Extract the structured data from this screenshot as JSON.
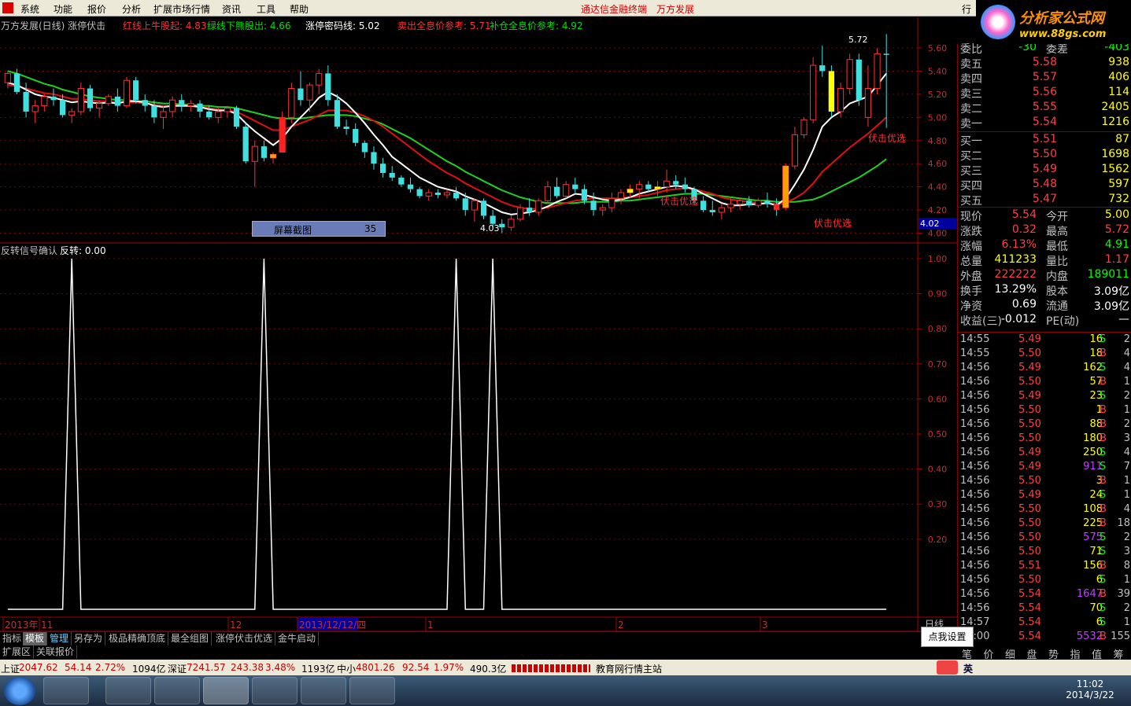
{
  "menu": {
    "items": [
      "系统",
      "功能",
      "报价",
      "分析",
      "扩展市场行情",
      "资讯",
      "工具",
      "帮助"
    ],
    "brand": "通达信金融终端",
    "company": "万方发展",
    "right_label": "行"
  },
  "watermark": {
    "line1": "分析家公式网",
    "line2": "www.88gs.com"
  },
  "header": {
    "title": "万方发展(日线) 涨停伏击",
    "red_up": "红线上牛股起: 4.83",
    "green_down": "绿线下熊股出: 4.66",
    "limit_line": "涨停密码线: 5.02",
    "sell_ref": "卖出全息价参考: 5.71",
    "add_ref": "补仓全息价参考: 4.92"
  },
  "chart_data": {
    "type": "candlestick",
    "x_labels": [
      "2013年",
      "11",
      "12",
      "2013/12/12/四",
      "1",
      "2",
      "3"
    ],
    "y_ticks": [
      "5.60",
      "5.40",
      "5.20",
      "5.00",
      "4.80",
      "4.60",
      "4.40",
      "4.20",
      "4.00"
    ],
    "current_price_marker": "4.02",
    "high_label": "5.72",
    "low_label": "4.03",
    "signal_labels": [
      "伏击优选",
      "伏击优选",
      "伏击优选"
    ],
    "screenshot_box": {
      "label": "屏幕截图",
      "value": "35"
    },
    "ohlc": [
      [
        5.3,
        5.4,
        5.25,
        5.38
      ],
      [
        5.38,
        5.42,
        5.2,
        5.22
      ],
      [
        5.22,
        5.3,
        5.0,
        5.05
      ],
      [
        5.05,
        5.15,
        4.95,
        5.1
      ],
      [
        5.1,
        5.2,
        5.05,
        5.18
      ],
      [
        5.18,
        5.25,
        5.1,
        5.15
      ],
      [
        5.15,
        5.2,
        5.0,
        5.02
      ],
      [
        5.02,
        5.08,
        4.95,
        5.05
      ],
      [
        5.05,
        5.3,
        5.02,
        5.25
      ],
      [
        5.25,
        5.28,
        5.05,
        5.08
      ],
      [
        5.08,
        5.15,
        5.0,
        5.12
      ],
      [
        5.12,
        5.2,
        5.1,
        5.18
      ],
      [
        5.18,
        5.25,
        5.05,
        5.1
      ],
      [
        5.1,
        5.35,
        5.08,
        5.32
      ],
      [
        5.32,
        5.35,
        5.12,
        5.15
      ],
      [
        5.15,
        5.2,
        5.05,
        5.1
      ],
      [
        5.1,
        5.15,
        4.95,
        5.0
      ],
      [
        5.0,
        5.1,
        4.9,
        5.05
      ],
      [
        5.05,
        5.18,
        5.0,
        5.15
      ],
      [
        5.15,
        5.2,
        5.05,
        5.1
      ],
      [
        5.1,
        5.15,
        5.05,
        5.12
      ],
      [
        5.12,
        5.15,
        5.0,
        5.05
      ],
      [
        5.05,
        5.1,
        4.98,
        5.0
      ],
      [
        5.0,
        5.08,
        4.95,
        5.05
      ],
      [
        5.05,
        5.1,
        5.0,
        5.08
      ],
      [
        5.08,
        5.1,
        4.9,
        4.92
      ],
      [
        4.92,
        4.95,
        4.6,
        4.62
      ],
      [
        4.62,
        4.8,
        4.4,
        4.75
      ],
      [
        4.75,
        4.8,
        4.62,
        4.65
      ],
      [
        4.65,
        4.7,
        4.6,
        4.68
      ],
      [
        4.7,
        5.05,
        4.7,
        5.0
      ],
      [
        5.0,
        5.3,
        4.95,
        5.25
      ],
      [
        5.25,
        5.4,
        5.1,
        5.15
      ],
      [
        5.15,
        5.3,
        5.05,
        5.28
      ],
      [
        5.28,
        5.42,
        5.2,
        5.38
      ],
      [
        5.38,
        5.45,
        5.1,
        5.15
      ],
      [
        5.15,
        5.2,
        4.9,
        4.92
      ],
      [
        4.92,
        4.98,
        4.85,
        4.9
      ],
      [
        4.9,
        4.95,
        4.75,
        4.78
      ],
      [
        4.78,
        4.8,
        4.65,
        4.7
      ],
      [
        4.7,
        4.75,
        4.55,
        4.6
      ],
      [
        4.6,
        4.65,
        4.48,
        4.52
      ],
      [
        4.52,
        4.58,
        4.45,
        4.48
      ],
      [
        4.48,
        4.5,
        4.4,
        4.42
      ],
      [
        4.42,
        4.48,
        4.35,
        4.38
      ],
      [
        4.38,
        4.4,
        4.3,
        4.32
      ],
      [
        4.32,
        4.38,
        4.28,
        4.35
      ],
      [
        4.35,
        4.38,
        4.3,
        4.33
      ],
      [
        4.33,
        4.38,
        4.3,
        4.35
      ],
      [
        4.35,
        4.4,
        4.28,
        4.3
      ],
      [
        4.3,
        4.35,
        4.15,
        4.2
      ],
      [
        4.2,
        4.3,
        4.1,
        4.28
      ],
      [
        4.28,
        4.3,
        4.12,
        4.15
      ],
      [
        4.15,
        4.2,
        4.05,
        4.08
      ],
      [
        4.08,
        4.12,
        4.0,
        4.05
      ],
      [
        4.05,
        4.15,
        4.02,
        4.12
      ],
      [
        4.12,
        4.25,
        4.1,
        4.22
      ],
      [
        4.22,
        4.3,
        4.15,
        4.18
      ],
      [
        4.18,
        4.3,
        4.15,
        4.28
      ],
      [
        4.28,
        4.45,
        4.25,
        4.4
      ],
      [
        4.4,
        4.48,
        4.3,
        4.32
      ],
      [
        4.32,
        4.45,
        4.3,
        4.42
      ],
      [
        4.42,
        4.48,
        4.35,
        4.38
      ],
      [
        4.38,
        4.42,
        4.25,
        4.28
      ],
      [
        4.28,
        4.35,
        4.15,
        4.2
      ],
      [
        4.2,
        4.25,
        4.15,
        4.22
      ],
      [
        4.22,
        4.35,
        4.18,
        4.3
      ],
      [
        4.3,
        4.38,
        4.25,
        4.35
      ],
      [
        4.35,
        4.42,
        4.3,
        4.38
      ],
      [
        4.38,
        4.45,
        4.3,
        4.42
      ],
      [
        4.42,
        4.45,
        4.35,
        4.38
      ],
      [
        4.38,
        4.45,
        4.32,
        4.4
      ],
      [
        4.4,
        4.55,
        4.35,
        4.45
      ],
      [
        4.45,
        4.5,
        4.38,
        4.42
      ],
      [
        4.42,
        4.48,
        4.35,
        4.38
      ],
      [
        4.38,
        4.4,
        4.25,
        4.28
      ],
      [
        4.28,
        4.32,
        4.18,
        4.2
      ],
      [
        4.2,
        4.28,
        4.15,
        4.18
      ],
      [
        4.18,
        4.25,
        4.12,
        4.22
      ],
      [
        4.22,
        4.3,
        4.18,
        4.25
      ],
      [
        4.25,
        4.3,
        4.2,
        4.28
      ],
      [
        4.28,
        4.32,
        4.22,
        4.24
      ],
      [
        4.24,
        4.3,
        4.22,
        4.28
      ],
      [
        4.28,
        4.35,
        4.22,
        4.25
      ],
      [
        4.25,
        4.3,
        4.15,
        4.2
      ],
      [
        4.22,
        4.6,
        4.2,
        4.58
      ],
      [
        4.58,
        4.92,
        4.55,
        4.85
      ],
      [
        4.85,
        5.0,
        4.82,
        4.98
      ],
      [
        4.98,
        5.52,
        4.95,
        5.45
      ],
      [
        5.45,
        5.62,
        5.35,
        5.4
      ],
      [
        5.4,
        5.45,
        5.0,
        5.05
      ],
      [
        5.05,
        5.3,
        5.0,
        5.25
      ],
      [
        5.25,
        5.55,
        5.2,
        5.5
      ],
      [
        5.5,
        5.55,
        5.1,
        5.15
      ],
      [
        5.0,
        5.45,
        4.92,
        5.25
      ],
      [
        5.25,
        5.6,
        5.2,
        5.55
      ],
      [
        5.55,
        5.72,
        4.91,
        5.54
      ]
    ],
    "ma_white": [
      5.3,
      5.28,
      5.24,
      5.2,
      5.18,
      5.17,
      5.15,
      5.13,
      5.14,
      5.13,
      5.12,
      5.13,
      5.12,
      5.14,
      5.14,
      5.13,
      5.1,
      5.09,
      5.1,
      5.1,
      5.1,
      5.09,
      5.07,
      5.06,
      5.06,
      5.03,
      4.95,
      4.88,
      4.82,
      4.76,
      4.82,
      4.92,
      5.0,
      5.08,
      5.17,
      5.22,
      5.18,
      5.12,
      5.04,
      4.95,
      4.85,
      4.76,
      4.66,
      4.6,
      4.54,
      4.48,
      4.44,
      4.4,
      4.38,
      4.36,
      4.32,
      4.29,
      4.26,
      4.22,
      4.18,
      4.16,
      4.17,
      4.18,
      4.2,
      4.23,
      4.27,
      4.3,
      4.34,
      4.33,
      4.31,
      4.29,
      4.28,
      4.29,
      4.31,
      4.34,
      4.36,
      4.38,
      4.4,
      4.41,
      4.4,
      4.38,
      4.34,
      4.3,
      4.26,
      4.24,
      4.24,
      4.25,
      4.25,
      4.26,
      4.24,
      4.3,
      4.42,
      4.55,
      4.72,
      4.92,
      5.0,
      5.05,
      5.12,
      5.15,
      5.18,
      5.28,
      5.38
    ],
    "ma_red": [
      5.28,
      5.27,
      5.25,
      5.23,
      5.21,
      5.2,
      5.18,
      5.16,
      5.16,
      5.15,
      5.14,
      5.14,
      5.13,
      5.13,
      5.13,
      5.12,
      5.11,
      5.1,
      5.1,
      5.1,
      5.1,
      5.09,
      5.08,
      5.07,
      5.06,
      5.05,
      5.01,
      4.97,
      4.93,
      4.89,
      4.89,
      4.92,
      4.95,
      4.98,
      5.02,
      5.06,
      5.06,
      5.06,
      5.04,
      5.01,
      4.97,
      4.92,
      4.86,
      4.8,
      4.74,
      4.68,
      4.62,
      4.57,
      4.52,
      4.48,
      4.43,
      4.39,
      4.35,
      4.31,
      4.27,
      4.24,
      4.22,
      4.21,
      4.21,
      4.22,
      4.24,
      4.26,
      4.28,
      4.29,
      4.3,
      4.3,
      4.3,
      4.3,
      4.31,
      4.32,
      4.33,
      4.35,
      4.37,
      4.38,
      4.39,
      4.38,
      4.36,
      4.34,
      4.31,
      4.29,
      4.28,
      4.27,
      4.26,
      4.26,
      4.25,
      4.26,
      4.3,
      4.35,
      4.43,
      4.53,
      4.6,
      4.67,
      4.74,
      4.8,
      4.86,
      4.93,
      5.0
    ],
    "ma_green": [
      5.4,
      5.38,
      5.35,
      5.32,
      5.29,
      5.27,
      5.24,
      5.22,
      5.2,
      5.18,
      5.17,
      5.16,
      5.15,
      5.15,
      5.14,
      5.14,
      5.13,
      5.12,
      5.12,
      5.11,
      5.11,
      5.1,
      5.1,
      5.09,
      5.09,
      5.08,
      5.06,
      5.04,
      5.02,
      5.0,
      4.99,
      4.99,
      4.99,
      5.0,
      5.01,
      5.02,
      5.02,
      5.02,
      5.01,
      4.99,
      4.97,
      4.94,
      4.9,
      4.86,
      4.82,
      4.77,
      4.72,
      4.67,
      4.62,
      4.58,
      4.53,
      4.49,
      4.45,
      4.41,
      4.37,
      4.34,
      4.31,
      4.29,
      4.27,
      4.26,
      4.26,
      4.26,
      4.26,
      4.27,
      4.27,
      4.27,
      4.27,
      4.28,
      4.28,
      4.29,
      4.3,
      4.31,
      4.32,
      4.33,
      4.34,
      4.34,
      4.34,
      4.33,
      4.32,
      4.31,
      4.3,
      4.29,
      4.28,
      4.28,
      4.27,
      4.27,
      4.27,
      4.28,
      4.29,
      4.32,
      4.36,
      4.4,
      4.44,
      4.48,
      4.53,
      4.58,
      4.64
    ],
    "indicator": {
      "title": "反转信号确认",
      "label": "反转: 0.00",
      "y_ticks": [
        "1.00",
        "0.90",
        "0.80",
        "0.70",
        "0.60",
        "0.50",
        "0.40",
        "0.30",
        "0.20"
      ],
      "ylim": [
        0,
        1
      ],
      "spikes_at_bar": [
        7,
        28,
        49,
        53
      ],
      "bars": 97
    }
  },
  "quote": {
    "weibi": {
      "label": "委比",
      "value": "-30",
      "label2": "委差",
      "value2": "-403"
    },
    "asks": [
      {
        "label": "卖五",
        "price": "5.58",
        "vol": "938"
      },
      {
        "label": "卖四",
        "price": "5.57",
        "vol": "406"
      },
      {
        "label": "卖三",
        "price": "5.56",
        "vol": "114"
      },
      {
        "label": "卖二",
        "price": "5.55",
        "vol": "2405"
      },
      {
        "label": "卖一",
        "price": "5.54",
        "vol": "1216"
      }
    ],
    "bids": [
      {
        "label": "买一",
        "price": "5.51",
        "vol": "87"
      },
      {
        "label": "买二",
        "price": "5.50",
        "vol": "1698"
      },
      {
        "label": "买三",
        "price": "5.49",
        "vol": "1562"
      },
      {
        "label": "买四",
        "price": "5.48",
        "vol": "597"
      },
      {
        "label": "买五",
        "price": "5.47",
        "vol": "732"
      }
    ],
    "stats": [
      {
        "l1": "现价",
        "v1": "5.54",
        "c1": "#ff4040",
        "l2": "今开",
        "v2": "5.00",
        "c2": "#ffff00"
      },
      {
        "l1": "涨跌",
        "v1": "0.32",
        "c1": "#ff4040",
        "l2": "最高",
        "v2": "5.72",
        "c2": "#ff4040"
      },
      {
        "l1": "涨幅",
        "v1": "6.13%",
        "c1": "#ff4040",
        "l2": "最低",
        "v2": "4.91",
        "c2": "#00ff00"
      },
      {
        "l1": "总量",
        "v1": "411233",
        "c1": "#ffff00",
        "l2": "量比",
        "v2": "1.17",
        "c2": "#ff4040"
      },
      {
        "l1": "外盘",
        "v1": "222222",
        "c1": "#ff4040",
        "l2": "内盘",
        "v2": "189011",
        "c2": "#00ff00"
      },
      {
        "l1": "换手",
        "v1": "13.29%",
        "c1": "#ffffff",
        "l2": "股本",
        "v2": "3.09亿",
        "c2": "#ffffff"
      },
      {
        "l1": "净资",
        "v1": "0.69",
        "c1": "#ffffff",
        "l2": "流通",
        "v2": "3.09亿",
        "c2": "#ffffff"
      },
      {
        "l1": "收益(三)",
        "v1": "-0.012",
        "c1": "#ffffff",
        "l2": "PE(动)",
        "v2": "—",
        "c2": "#ffffff"
      }
    ],
    "ticks": [
      {
        "t": "14:55",
        "p": "5.49",
        "v": "16",
        "s": "S",
        "n": "2"
      },
      {
        "t": "14:55",
        "p": "5.50",
        "v": "18",
        "s": "B",
        "n": "4"
      },
      {
        "t": "14:56",
        "p": "5.49",
        "v": "162",
        "s": "S",
        "n": "4"
      },
      {
        "t": "14:56",
        "p": "5.50",
        "v": "57",
        "s": "B",
        "n": "1"
      },
      {
        "t": "14:56",
        "p": "5.49",
        "v": "23",
        "s": "S",
        "n": "2"
      },
      {
        "t": "14:56",
        "p": "5.50",
        "v": "1",
        "s": "B",
        "n": "1"
      },
      {
        "t": "14:56",
        "p": "5.50",
        "v": "88",
        "s": "B",
        "n": "2"
      },
      {
        "t": "14:56",
        "p": "5.50",
        "v": "180",
        "s": "B",
        "n": "3"
      },
      {
        "t": "14:56",
        "p": "5.49",
        "v": "250",
        "s": "S",
        "n": "4"
      },
      {
        "t": "14:56",
        "p": "5.49",
        "v": "911",
        "s": "S",
        "n": "7"
      },
      {
        "t": "14:56",
        "p": "5.50",
        "v": "3",
        "s": "B",
        "n": "1"
      },
      {
        "t": "14:56",
        "p": "5.49",
        "v": "24",
        "s": "S",
        "n": "1"
      },
      {
        "t": "14:56",
        "p": "5.50",
        "v": "108",
        "s": "B",
        "n": "4"
      },
      {
        "t": "14:56",
        "p": "5.50",
        "v": "225",
        "s": "B",
        "n": "18"
      },
      {
        "t": "14:56",
        "p": "5.50",
        "v": "575",
        "s": "S",
        "n": "2"
      },
      {
        "t": "14:56",
        "p": "5.50",
        "v": "71",
        "s": "S",
        "n": "3"
      },
      {
        "t": "14:56",
        "p": "5.51",
        "v": "156",
        "s": "B",
        "n": "8"
      },
      {
        "t": "14:56",
        "p": "5.50",
        "v": "6",
        "s": "S",
        "n": "1"
      },
      {
        "t": "14:56",
        "p": "5.54",
        "v": "1647",
        "s": "B",
        "n": "39"
      },
      {
        "t": "14:56",
        "p": "5.54",
        "v": "70",
        "s": "S",
        "n": "2"
      },
      {
        "t": "14:57",
        "p": "5.54",
        "v": "6",
        "s": "S",
        "n": "1"
      },
      {
        "t": "15:00",
        "p": "5.54",
        "v": "5532",
        "s": "B",
        "n": "155"
      }
    ],
    "rtabs": [
      "笔",
      "价",
      "细",
      "盘",
      "势",
      "指",
      "值",
      "筹"
    ]
  },
  "period_label": "日线",
  "tooltip": "点我设置",
  "tabs1": [
    "指标",
    "模板",
    "管理",
    "另存为",
    "极品精确顶底",
    "最全组图",
    "涨停伏击优选",
    "金牛启动"
  ],
  "tabs2": [
    "扩展区",
    "关联报价"
  ],
  "status": {
    "sh_label": "上证",
    "sh_val": "2047.62",
    "sh_chg": "54.14",
    "sh_pct": "2.72%",
    "sh_amt": "1094亿",
    "sz_label": "深证",
    "sz_val": "7241.57",
    "sz_chg": "243.38",
    "sz_pct": "3.48%",
    "sz_amt": "1193亿",
    "zx_label": "中小",
    "zx_val": "4801.26",
    "zx_chg": "92.54",
    "zx_pct": "1.97%",
    "zx_amt": "490.3亿",
    "marquee": "教育网行情主站",
    "ime": "英"
  },
  "taskbar": {
    "time": "11:02",
    "date": "2014/3/22"
  }
}
